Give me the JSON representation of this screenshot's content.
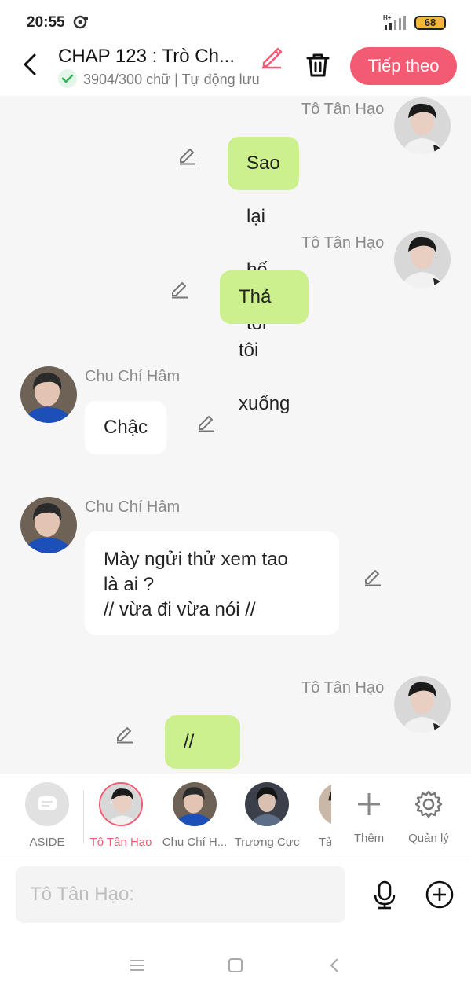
{
  "status_bar": {
    "time": "20:55",
    "network": "H+",
    "battery": "68"
  },
  "header": {
    "title": "CHAP 123 : Trò Ch...",
    "word_count": "3904/300 chữ",
    "separator": "|",
    "autosave": "Tự động lưu",
    "next_label": "Tiếp theo"
  },
  "messages": [
    {
      "side": "right",
      "sender": "Tô Tân Hạo",
      "text": "Sao lại bế tôi"
    },
    {
      "side": "right",
      "sender": "Tô Tân Hạo",
      "text": "Thả tôi xuống"
    },
    {
      "side": "left",
      "sender": "Chu Chí Hâm",
      "text": "Chậc"
    },
    {
      "side": "left",
      "sender": "Chu Chí Hâm",
      "text": "Mày ngửi thử xem tao",
      "text2": "là ai ?",
      "text3": "// vừa đi vừa nói //"
    },
    {
      "side": "right",
      "sender": "Tô Tân Hạo",
      "text": "// ngửi lấy cổ anh //"
    }
  ],
  "characters": [
    {
      "label": "ASIDE"
    },
    {
      "label": "Tô Tân Hạo"
    },
    {
      "label": "Chu Chí H..."
    },
    {
      "label": "Trương Cực"
    },
    {
      "label": "Tả"
    }
  ],
  "actions": {
    "add_label": "Thêm",
    "manage_label": "Quản lý"
  },
  "composer": {
    "placeholder": "Tô Tân Hạo:"
  },
  "colors": {
    "accent": "#f35b73",
    "right_bubble": "#cdf08e",
    "left_bubble": "#ffffff",
    "background": "#f6f6f6"
  }
}
